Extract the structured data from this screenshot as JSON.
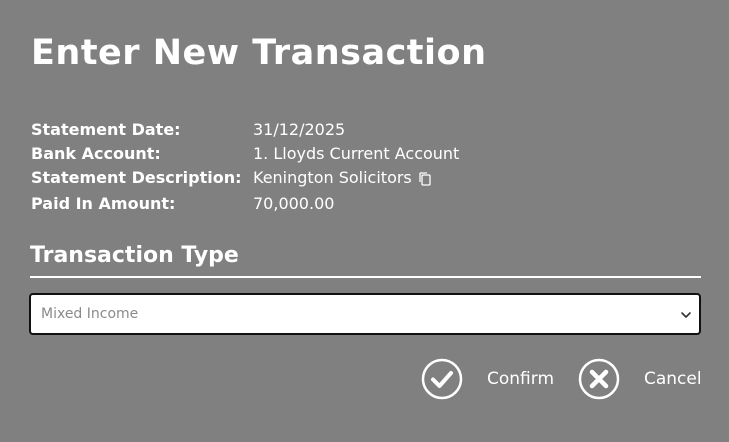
{
  "dialog": {
    "title": "Enter New Transaction"
  },
  "details": {
    "statement_date": {
      "label": "Statement Date:",
      "value": "31/12/2025"
    },
    "bank_account": {
      "label": "Bank Account:",
      "value": "1. Lloyds Current Account"
    },
    "statement_description": {
      "label": "Statement Description:",
      "value": "Kenington Solicitors",
      "icon": "copy-icon"
    },
    "paid_in_amount": {
      "label": "Paid In Amount:",
      "value": "70,000.00"
    }
  },
  "transaction_type": {
    "heading": "Transaction Type",
    "selected": "Mixed Income",
    "icon": "chevron-down-icon"
  },
  "actions": {
    "confirm": {
      "label": "Confirm",
      "icon": "check-circle-icon"
    },
    "cancel": {
      "label": "Cancel",
      "icon": "x-circle-icon"
    }
  },
  "colors": {
    "background": "#808080",
    "text": "#ffffff",
    "select_text": "#8a8a8a"
  }
}
